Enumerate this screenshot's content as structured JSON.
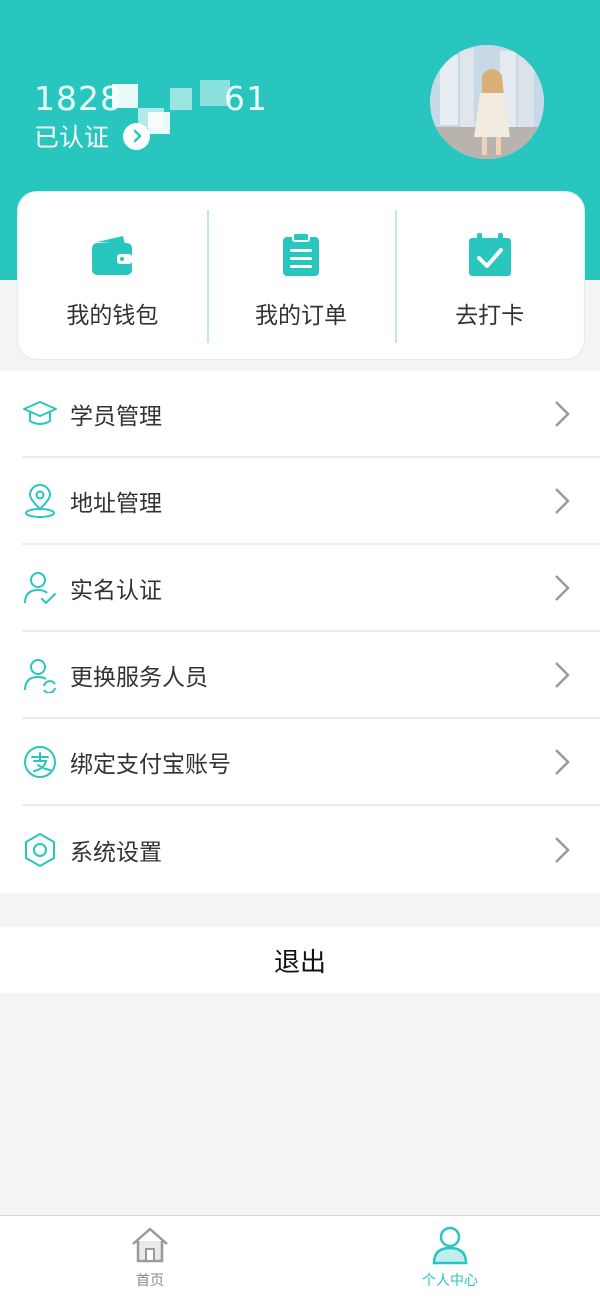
{
  "header": {
    "phone_masked": "1828　　　61",
    "verified_label": "已认证"
  },
  "quick_actions": [
    {
      "label": "我的钱包",
      "icon": "wallet-icon"
    },
    {
      "label": "我的订单",
      "icon": "order-icon"
    },
    {
      "label": "去打卡",
      "icon": "calendar-check-icon"
    }
  ],
  "menu": [
    {
      "label": "学员管理",
      "icon": "graduation-cap-icon"
    },
    {
      "label": "地址管理",
      "icon": "location-icon"
    },
    {
      "label": "实名认证",
      "icon": "user-verify-icon"
    },
    {
      "label": "更换服务人员",
      "icon": "user-switch-icon"
    },
    {
      "label": "绑定支付宝账号",
      "icon": "alipay-icon"
    },
    {
      "label": "系统设置",
      "icon": "settings-hexagon-icon"
    }
  ],
  "logout_label": "退出",
  "tabbar": {
    "home_label": "首页",
    "me_label": "个人中心"
  },
  "colors": {
    "accent": "#29c6c0",
    "background": "#f4f4f4"
  }
}
